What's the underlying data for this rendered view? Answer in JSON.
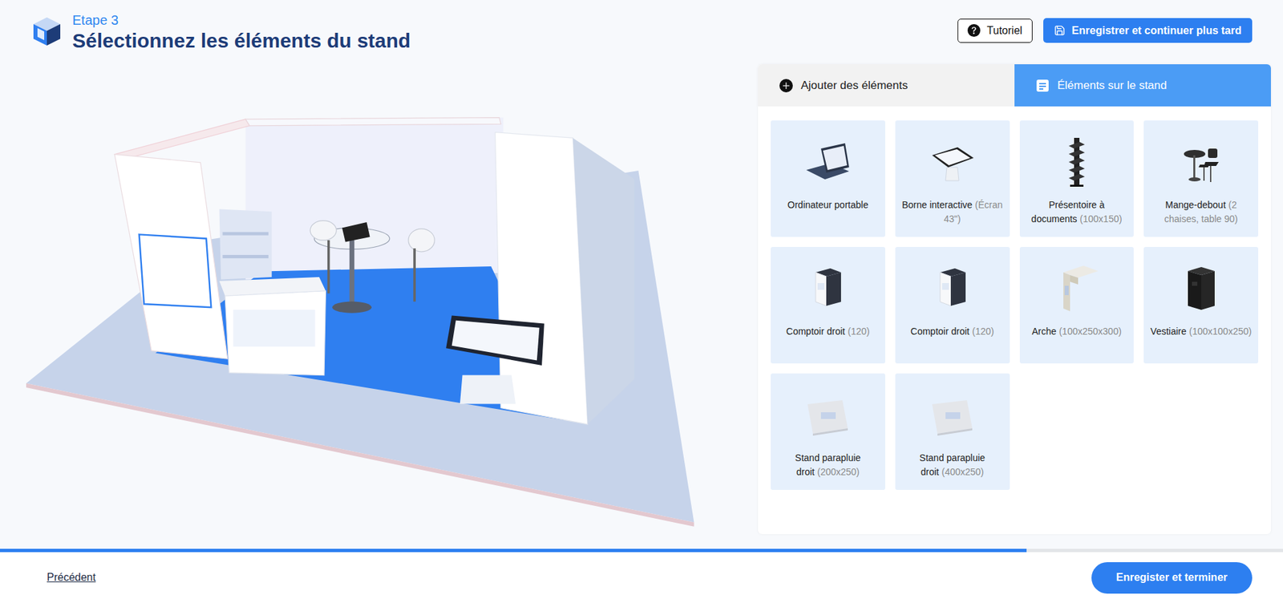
{
  "header": {
    "step": "Etape 3",
    "title": "Sélectionnez les éléments du stand"
  },
  "toolbar": {
    "tutorial": "Tutoriel",
    "save": "Enregistrer et continuer plus tard"
  },
  "tabs": [
    {
      "label": "Ajouter des éléments",
      "selected": false,
      "kind": "add"
    },
    {
      "label": "Éléments sur le stand",
      "selected": true,
      "kind": "list"
    }
  ],
  "items": [
    {
      "name": "Ordinateur portable",
      "kind": "laptop"
    },
    {
      "name": "Borne interactive",
      "detail": "(Écran 43\")",
      "kind": "kiosk"
    },
    {
      "name": "Présentoire à documents",
      "detail": "(100x150)",
      "kind": "rack"
    },
    {
      "name": "Mange-debout",
      "detail": "(2 chaises, table 90)",
      "kind": "table"
    },
    {
      "name": "Comptoir droit",
      "detail": "(120)",
      "kind": "counter"
    },
    {
      "name": "Comptoir droit",
      "detail": "(120)",
      "kind": "counter"
    },
    {
      "name": "Arche",
      "detail": "(100x250x300)",
      "kind": "arch"
    },
    {
      "name": "Vestiaire",
      "detail": "(100x100x250)",
      "kind": "cloakroom"
    },
    {
      "name": "Stand parapluie droit",
      "detail": "(200x250)",
      "kind": "banner"
    },
    {
      "name": "Stand parapluie droit",
      "detail": "(400x250)",
      "kind": "banner"
    }
  ],
  "progress": {
    "level": 0.8
  },
  "footer": {
    "back": "Précédent",
    "finish": "Enregister et terminer"
  }
}
